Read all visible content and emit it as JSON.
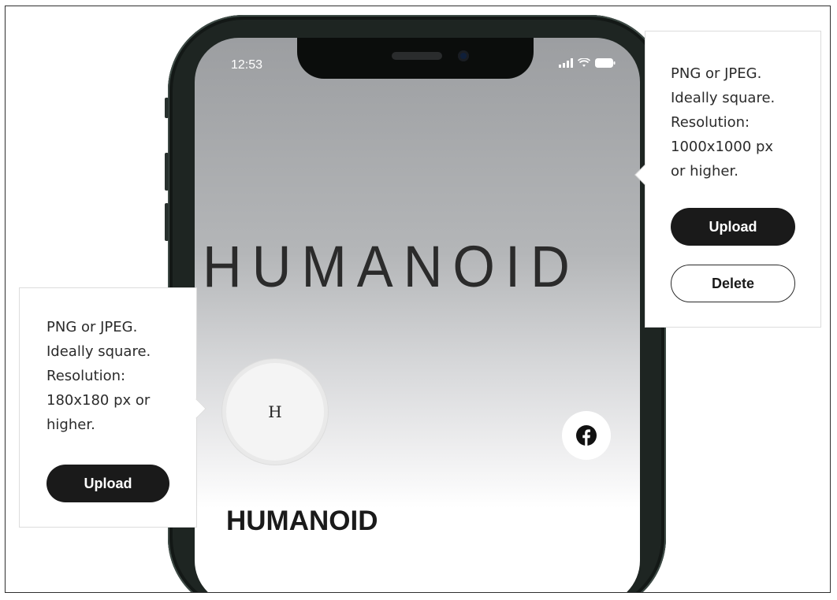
{
  "phone": {
    "status_time": "12:53",
    "cover_title": "HUMANOID",
    "avatar_letter": "H",
    "profile_name": "HUMANOID",
    "social_icon": "facebook-icon"
  },
  "cover_popover": {
    "description": "PNG or JPEG.\nIdeally square.\nResolution:\n1000x1000 px\nor higher.",
    "upload_label": "Upload",
    "delete_label": "Delete"
  },
  "avatar_popover": {
    "description": "PNG or JPEG.\nIdeally square.\nResolution:\n180x180 px or\nhigher.",
    "upload_label": "Upload"
  },
  "colors": {
    "button_dark": "#1a1a1a",
    "phone_frame": "#1e2522"
  }
}
